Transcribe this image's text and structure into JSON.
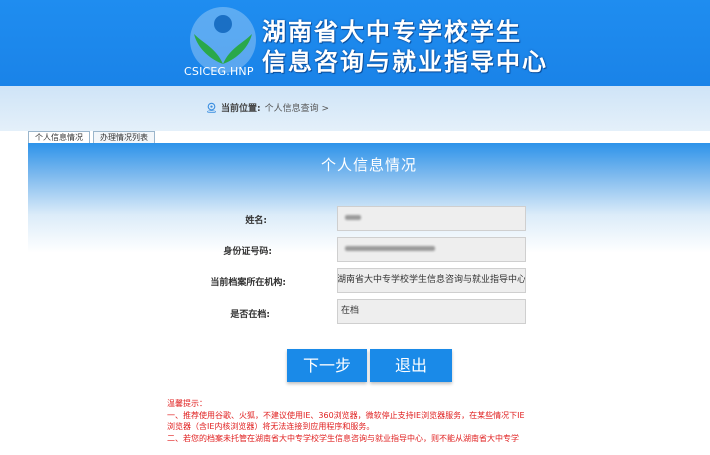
{
  "header": {
    "title_line1": "湖南省大中专学校学生",
    "title_line2": "信息咨询与就业指导中心",
    "logo_text": "CSICEG.HNP"
  },
  "breadcrumb": {
    "label": "当前位置:",
    "path": "个人信息查询 >"
  },
  "tabs": [
    {
      "label": "个人信息情况",
      "active": true
    },
    {
      "label": "办理情况列表",
      "active": false
    }
  ],
  "panel": {
    "title": "个人信息情况"
  },
  "form": {
    "name_label": "姓名:",
    "id_label": "身份证号码:",
    "org_label": "当前档案所在机构:",
    "org_value": "湖南省大中专学校学生信息咨询与就业指导中心",
    "status_label": "是否在档:",
    "status_value": "在档"
  },
  "buttons": {
    "next": "下一步",
    "exit": "退出"
  },
  "notice": {
    "heading": "温馨提示：",
    "line1": "一、推荐使用谷歌、火狐，不建议使用IE、360浏览器，微软停止支持IE浏览器服务，在某些情况下IE",
    "line2": "浏览器（含IE内核浏览器）将无法连接到应用程序和服务。",
    "line3": "二、若您的档案未托管在湖南省大中专学校学生信息咨询与就业指导中心，则不能从湖南省大中专学"
  },
  "colors": {
    "header_blue": "#1f8df0",
    "button_blue": "#1a8ae8",
    "notice_red": "#e02020"
  }
}
